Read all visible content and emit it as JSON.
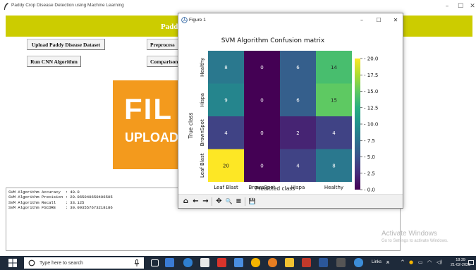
{
  "app": {
    "title": "Paddy Crop Disease Detection using Machine Learning",
    "banner_title": "Paddy",
    "buttons": {
      "upload": "Upload Paddy Disease Dataset",
      "preprocess": "Preprocess",
      "run_cnn": "Run CNN Algorithm",
      "comparison": "Comparison"
    },
    "banner_image_text": [
      "FIL",
      "UPLOAD"
    ],
    "output_lines": [
      "SVM Algorithm Accuracy  : 40.0",
      "SVM Algorithm Precision : 29.065040650406505",
      "SVM Algorithm Recall    : 33.125",
      "SVM Algorithm FSCORE    : 30.093557673218186"
    ],
    "window_controls": [
      "–",
      "☐",
      "✕"
    ]
  },
  "figure": {
    "title": "Figure 1",
    "controls": [
      "–",
      "☐",
      "✕"
    ],
    "toolbar_icons": [
      "home-icon",
      "back-arrow-icon",
      "forward-arrow-icon",
      "pan-icon",
      "zoom-icon",
      "configure-subplots-icon",
      "save-icon"
    ],
    "toolbar_glyphs": [
      "⌂",
      "←",
      "→",
      "✥",
      "🔍",
      "≡",
      "💾"
    ]
  },
  "chart_data": {
    "type": "heatmap",
    "title": "SVM Algorithm Confusion matrix",
    "xlabel": "Predicted class",
    "ylabel": "True class",
    "x_categories": [
      "Leaf Blast",
      "BrownSpot",
      "Hispa",
      "Healthy"
    ],
    "y_categories": [
      "Healthy",
      "Hispa",
      "BrownSpot",
      "Leaf Blast"
    ],
    "values": [
      [
        8,
        0,
        6,
        14
      ],
      [
        9,
        0,
        6,
        15
      ],
      [
        4,
        0,
        2,
        4
      ],
      [
        20,
        0,
        4,
        8
      ]
    ],
    "colorbar_ticks": [
      "0.0",
      "2.5",
      "5.0",
      "7.5",
      "10.0",
      "12.5",
      "15.0",
      "17.5",
      "20.0"
    ],
    "colorbar_range": [
      0,
      20
    ],
    "colormap": "viridis"
  },
  "desktop": {
    "watermark_title": "Activate Windows",
    "watermark_sub": "Go to Settings to activate Windows."
  },
  "taskbar": {
    "search_placeholder": "Type here to search",
    "links_label": "Links",
    "time": "18:39",
    "date": "21-02-2023"
  }
}
